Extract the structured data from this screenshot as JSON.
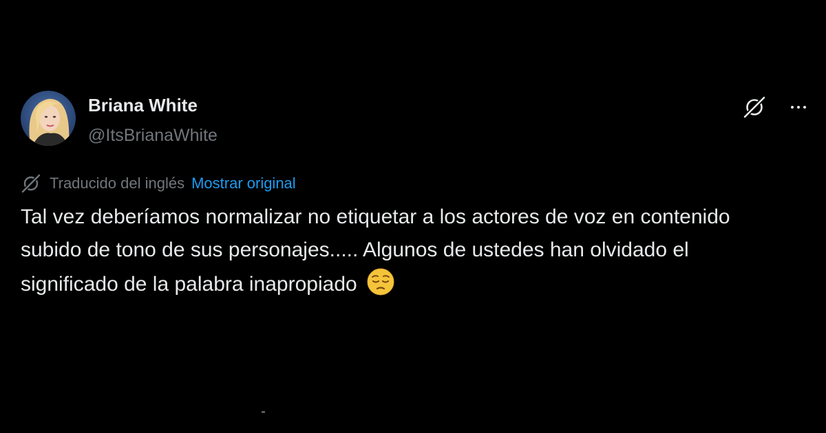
{
  "user": {
    "display_name": "Briana White",
    "handle": "@ItsBrianaWhite",
    "avatar_icon": "user-avatar-photo"
  },
  "actions": {
    "grok_icon": "grok-icon",
    "more_icon": "more-options-icon"
  },
  "translation": {
    "icon": "grok-icon",
    "label": "Traducido del inglés",
    "show_original": "Mostrar original"
  },
  "tweet": {
    "text": "Tal vez deberíamos normalizar no etiquetar a los actores de voz en contenido subido de tono de sus personajes..... Algunos de ustedes han olvidado el significado de la palabra inapropiado",
    "emoji": "pensive-face"
  },
  "colors": {
    "background": "#000000",
    "text_primary": "#e7e9ea",
    "text_secondary": "#71767b",
    "link": "#1d9bf0",
    "emoji_yellow": "#f4c43b"
  }
}
